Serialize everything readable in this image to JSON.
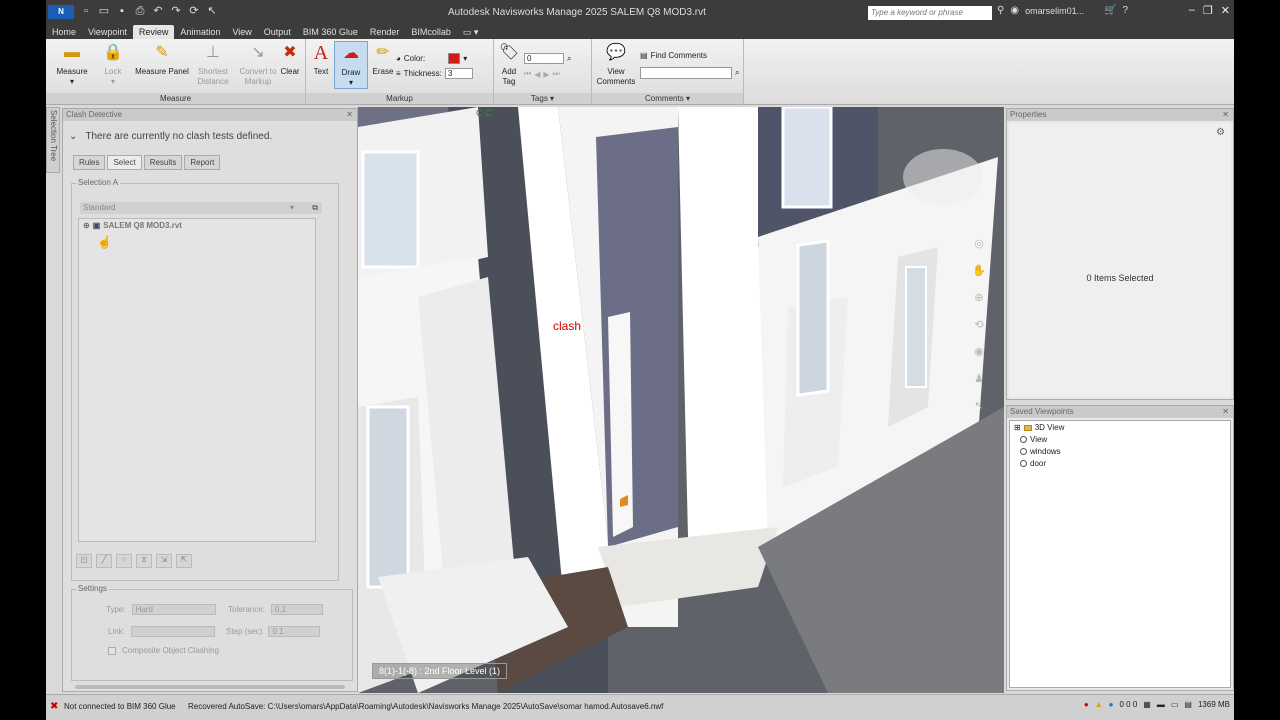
{
  "window": {
    "app_title": "Autodesk Navisworks Manage 2025   SALEM Q8 MOD3.rvt",
    "logo_text": "N",
    "search_placeholder": "Type a keyword or phrase",
    "user": "omarselim01..."
  },
  "tabs": [
    "Home",
    "Viewpoint",
    "Review",
    "Animation",
    "View",
    "Output",
    "BIM 360 Glue",
    "Render",
    "BIMcollab"
  ],
  "active_tab": "Review",
  "ribbon": {
    "measure": {
      "label": "Measure"
    },
    "lock": {
      "label": "Lock"
    },
    "measure_panel": {
      "label": "Measure Panel"
    },
    "shortest": {
      "label": "Shortest Distance"
    },
    "convert": {
      "label": "Convert to Markup"
    },
    "clear": {
      "label": "Clear"
    },
    "group_measure": "Measure",
    "text": {
      "label": "Text"
    },
    "draw": {
      "label": "Draw"
    },
    "erase": {
      "label": "Erase"
    },
    "color_label": "Color:",
    "thickness_label": "Thickness:",
    "thickness_value": "3",
    "group_markup": "Markup",
    "add_tag": {
      "label": "Add Tag"
    },
    "tag_value": "0",
    "group_tags": "Tags",
    "view_comments": {
      "label": "View Comments"
    },
    "find_comments": {
      "label": "Find Comments"
    },
    "group_comments": "Comments"
  },
  "sidetab_label": "Selection Tree",
  "clash": {
    "title": "Clash Detective",
    "message": "There are currently no clash tests defined.",
    "subtabs": [
      "Rules",
      "Select",
      "Results",
      "Report"
    ],
    "active_subtab": "Select",
    "selection_a_label": "Selection A",
    "dropdown_value": "Standard",
    "tree_item": "SALEM Q8 MOD3.rvt",
    "settings_label": "Settings",
    "type_label": "Type:",
    "type_value": "Hard",
    "tolerance_label": "Tolerance:",
    "tolerance_value": "0.1",
    "link_label": "Link:",
    "step_label": "Step (sec)",
    "step_value": "0.1",
    "composite_label": "Composite Object Clashing"
  },
  "viewport": {
    "annotation": "clash",
    "green_marks": "C   C",
    "view_label": "8(1)-1(-8) : 2nd Floor Level (1)"
  },
  "properties": {
    "title": "Properties",
    "empty_text": "0 Items Selected"
  },
  "saved_viewpoints": {
    "title": "Saved Viewpoints",
    "items": [
      "3D View",
      "View",
      "windows",
      "door"
    ]
  },
  "status": {
    "glue": "Not connected to BIM 360 Glue",
    "autosave": "Recovered AutoSave: C:\\Users\\omars\\AppData\\Roaming\\Autodesk\\Navisworks Manage 2025\\AutoSave\\somar hamod.Autosave6.nwf",
    "counts": "0   0   0",
    "memory": "1369 MB"
  },
  "colors": {
    "accent": "#1c5db6",
    "markup_red": "#d11a1a",
    "titlebar": "#3c3c3c"
  }
}
